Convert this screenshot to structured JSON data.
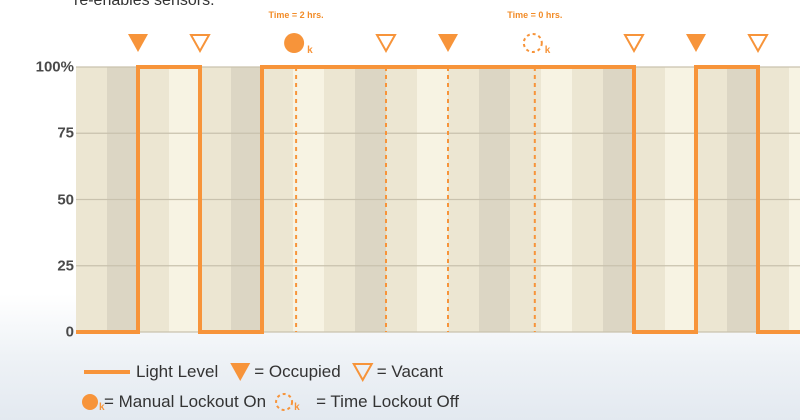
{
  "header_text": "re-enables sensors.",
  "time_labels": [
    "Time = 2 hrs.",
    "Time = 0 hrs."
  ],
  "marker_sub": "k",
  "colors": {
    "accent": "#f7943a",
    "accent_dark": "#f28c28",
    "stripe_dark": "#dcd6c4",
    "stripe_mid": "#ece6d2",
    "stripe_light": "#f7f3e3",
    "axis_text": "#4a4a4a"
  },
  "legend": {
    "light_level": "Light Level",
    "occupied": "= Occupied",
    "vacant": "= Vacant",
    "manual_lockout": "= Manual Lockout On",
    "time_lockout": "= Time Lockout Off"
  },
  "chart_data": {
    "type": "line",
    "y_ticks": [
      "100%",
      "75",
      "50",
      "25",
      "0"
    ],
    "ylim": [
      0,
      100
    ],
    "grid": true,
    "x_steps": 12,
    "series": [
      {
        "name": "Light Level",
        "points": [
          [
            0,
            0
          ],
          [
            1,
            0
          ],
          [
            1,
            100
          ],
          [
            2,
            100
          ],
          [
            2,
            0
          ],
          [
            3,
            0
          ],
          [
            3,
            100
          ],
          [
            9,
            100
          ],
          [
            9,
            0
          ],
          [
            10,
            0
          ],
          [
            10,
            100
          ],
          [
            11,
            100
          ],
          [
            11,
            0
          ],
          [
            12,
            0
          ]
        ]
      }
    ],
    "events": [
      {
        "x": 1,
        "type": "occupied"
      },
      {
        "x": 2,
        "type": "vacant"
      },
      {
        "x": 3.55,
        "type": "manual_lockout_on"
      },
      {
        "x": 5,
        "type": "vacant"
      },
      {
        "x": 6,
        "type": "occupied"
      },
      {
        "x": 7.4,
        "type": "time_lockout_off"
      },
      {
        "x": 9,
        "type": "vacant"
      },
      {
        "x": 10,
        "type": "occupied"
      },
      {
        "x": 11,
        "type": "vacant"
      }
    ],
    "dashed_lines_x": [
      3.55,
      5,
      6,
      7.4
    ],
    "time_label_x": [
      3.55,
      7.4
    ]
  }
}
